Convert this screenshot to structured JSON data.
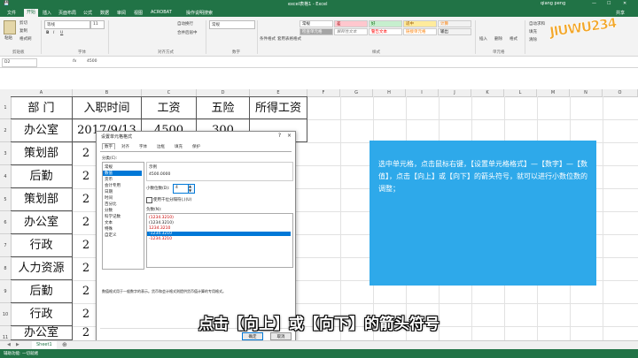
{
  "titlebar": {
    "doc_title": "excel表格1 - Excel",
    "user": "qiang peng",
    "quick_save": "💾"
  },
  "ribbon_tabs": [
    "文件",
    "开始",
    "插入",
    "页面布局",
    "公式",
    "数据",
    "审阅",
    "视图",
    "ACROBAT",
    "操作说明搜索"
  ],
  "share": "共享",
  "ribbon": {
    "clipboard": {
      "paste": "粘贴",
      "cut": "剪切",
      "copy": "复制",
      "format_painter": "格式刷",
      "group": "剪贴板"
    },
    "font": {
      "font_name": "等线",
      "font_size": "11",
      "bold": "B",
      "italic": "I",
      "underline": "U",
      "group": "字体"
    },
    "alignment": {
      "wrap": "自动换行",
      "merge": "合并后居中",
      "group": "对齐方式"
    },
    "number": {
      "format": "常规",
      "group": "数字"
    },
    "styles": {
      "cond_format": "条件格式",
      "table_format": "套用表格格式",
      "normal": "常规",
      "bad": "差",
      "good": "好",
      "neutral": "适中",
      "calc": "计算",
      "check_cell": "检查单元格",
      "explain": "解释性文本",
      "warning": "警告文本",
      "link_cell": "链接单元格",
      "output": "输出",
      "group": "样式"
    },
    "cells": {
      "insert": "插入",
      "delete": "删除",
      "format": "格式",
      "group": "单元格"
    },
    "editing": {
      "autosum": "自动求和",
      "fill": "填充",
      "clear": "清除"
    }
  },
  "formula_bar": {
    "name_box": "D2",
    "fx": "fx",
    "value": "4500"
  },
  "columns": [
    "A",
    "B",
    "C",
    "D",
    "E",
    "F",
    "G",
    "H",
    "I",
    "J",
    "K",
    "L",
    "M",
    "N",
    "O"
  ],
  "rows": [
    "1",
    "2",
    "3",
    "4",
    "5",
    "6",
    "7",
    "8",
    "9",
    "10",
    "11"
  ],
  "sheet": {
    "headers": [
      "部  门",
      "入职时间",
      "工资",
      "五险",
      "所得工资"
    ],
    "row2": {
      "dept": "办公室",
      "date": "2017/9/13",
      "salary": "4500",
      "insurance": "300"
    },
    "depts": [
      "策划部",
      "后勤",
      "策划部",
      "办公室",
      "行政",
      "人力资源",
      "后勤",
      "行政",
      "办公室"
    ],
    "date_stub": [
      "2",
      "2",
      "2",
      "2",
      "2",
      "2",
      "2",
      "2",
      "2"
    ]
  },
  "dialog": {
    "title": "设置单元格格式",
    "close": "×",
    "help": "?",
    "tabs": [
      "数字",
      "对齐",
      "字体",
      "边框",
      "填充",
      "保护"
    ],
    "category_label": "分类(C):",
    "categories": [
      "常规",
      "数值",
      "货币",
      "会计专用",
      "日期",
      "时间",
      "百分比",
      "分数",
      "科学记数",
      "文本",
      "特殊",
      "自定义"
    ],
    "sample_label": "示例",
    "sample_value": "4500.0000",
    "decimal_label": "小数位数(D):",
    "decimal_value": "4",
    "thousands_label": "使用千位分隔符(,)(U)",
    "negative_label": "负数(N):",
    "negatives": [
      "(1234.3210)",
      "(1234.3210)",
      "1234.3210",
      "-1234.3210",
      "-1234.3210"
    ],
    "description": "数值格式用于一般数字的表示。货币和会计格式则提供货币值计算的专用格式。",
    "ok": "确定",
    "cancel": "取消"
  },
  "note": "选中单元格，点击鼠标右键，【设置单元格格式】—【数字】—【数值】，点击【向上】或【向下】的箭头符号，就可以进行小数位数的调整；",
  "subtitle": "点击【向上】或【向下】的箭头符号",
  "sheet_tab": "Sheet1",
  "status": "辅助功能: 一切就绪",
  "logo_text": "JIUWU234",
  "colors": {
    "excel_green": "#217346",
    "note_blue": "#2ea9ea",
    "select_blue": "#0078d7"
  }
}
